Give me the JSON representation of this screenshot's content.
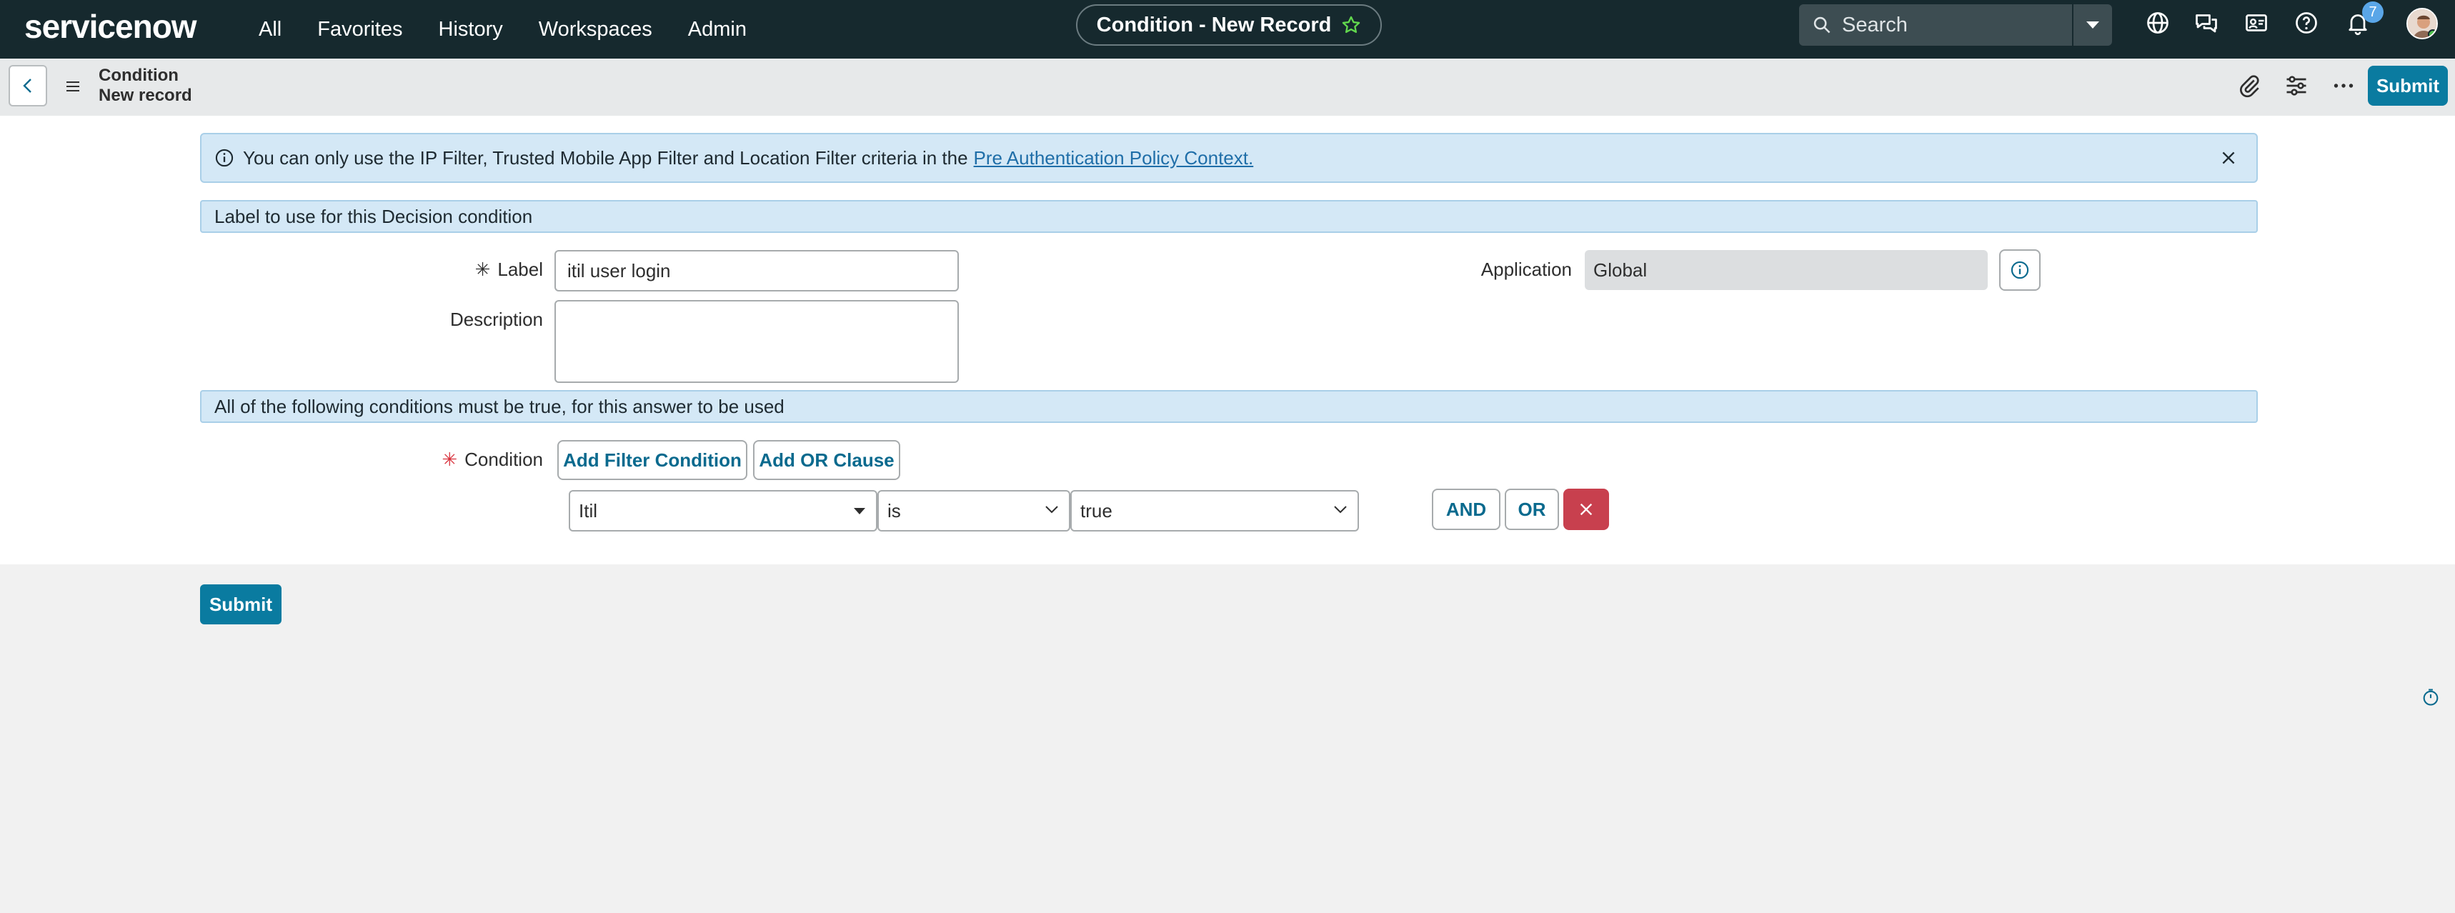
{
  "nav": {
    "logo": "servicenow",
    "links": [
      "All",
      "Favorites",
      "History",
      "Workspaces",
      "Admin"
    ],
    "record_title": "Condition - New Record",
    "search_placeholder": "Search",
    "notification_count": "7"
  },
  "header": {
    "title_line1": "Condition",
    "title_line2": "New record",
    "submit_label": "Submit"
  },
  "alert": {
    "text": "You can only use the IP Filter, Trusted Mobile App Filter and Location Filter criteria in the",
    "link_text": "Pre Authentication Policy Context."
  },
  "form": {
    "section1_title": "Label to use for this Decision condition",
    "label_label": "Label",
    "label_value": "itil user login",
    "description_label": "Description",
    "description_value": "",
    "application_label": "Application",
    "application_value": "Global",
    "section2_title": "All of the following conditions must be true, for this answer to be used",
    "condition_label": "Condition",
    "add_filter_label": "Add Filter Condition",
    "add_or_label": "Add OR Clause",
    "filter": {
      "field": "Itil",
      "operator": "is",
      "value": "true"
    },
    "and_label": "AND",
    "or_label": "OR",
    "submit_label": "Submit"
  },
  "colors": {
    "nav_bg": "#16292e",
    "accent": "#0a7ba0",
    "alert_bg": "#d4e8f6",
    "delete": "#c8404e",
    "star": "#62d84e"
  }
}
